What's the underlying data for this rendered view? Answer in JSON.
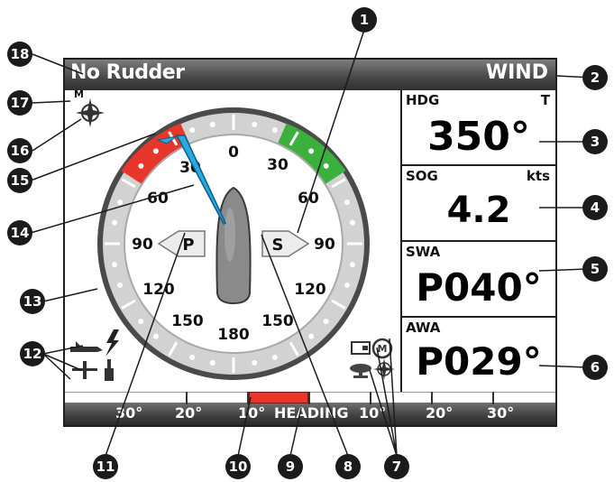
{
  "topbar": {
    "mode_left": "No Rudder",
    "mode_right": "WIND"
  },
  "compass": {
    "north_label": "M",
    "tick_labels": {
      "t0": "0",
      "t30r": "30",
      "t30l": "30",
      "t60r": "60",
      "t60l": "60",
      "t90r": "90",
      "t90l": "90",
      "t120r": "120",
      "t120l": "120",
      "t150r": "150",
      "t150l": "150",
      "t180": "180"
    },
    "port_label": "P",
    "starboard_label": "S",
    "colors": {
      "port_zone": "#e8362a",
      "starboard_zone": "#3cb03c",
      "pointer": "#2aa8e0",
      "ring": "#c8c8c8"
    }
  },
  "panels": [
    {
      "label": "HDG",
      "unit": "T",
      "value": "350°"
    },
    {
      "label": "SOG",
      "unit": "kts",
      "value": "4.2"
    },
    {
      "label": "SWA",
      "unit": "",
      "value": "P040°"
    },
    {
      "label": "AWA",
      "unit": "",
      "value": "P029°"
    }
  ],
  "strip": {
    "center_label": "HEADING",
    "labels": {
      "l30": "30°",
      "l20": "20°",
      "l10": "10°",
      "r10": "10°",
      "r20": "20°",
      "r30": "30°"
    },
    "indicator_color": "#e8362a"
  },
  "callouts": [
    "1",
    "2",
    "3",
    "4",
    "5",
    "6",
    "7",
    "8",
    "9",
    "10",
    "11",
    "12",
    "13",
    "14",
    "15",
    "16",
    "17",
    "18"
  ],
  "icons": [
    "compass-rose-icon",
    "autopilot-icon",
    "lightning-icon",
    "rudder-icon",
    "sensor-icon",
    "chart-plotter-icon",
    "motor-icon",
    "radar-icon",
    "compass-rose-small-icon"
  ]
}
